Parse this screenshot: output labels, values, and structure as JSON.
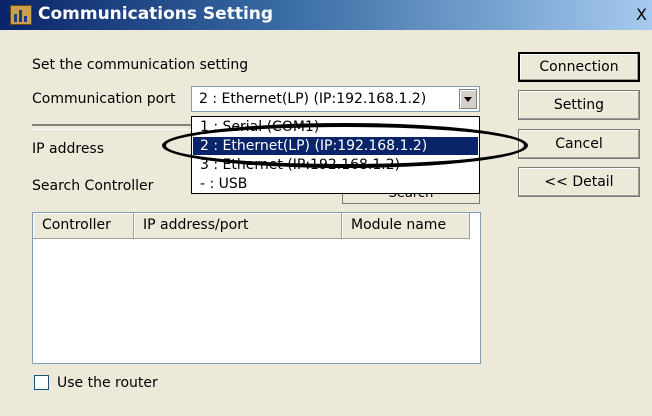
{
  "window": {
    "title": "Communications Setting",
    "close_glyph": "X",
    "icon": "app-icon"
  },
  "form": {
    "instruction": "Set the communication setting",
    "port_label": "Communication port",
    "port_value": "2 : Ethernet(LP) (IP:192.168.1.2)",
    "ip_label": "IP address",
    "search_label": "Search Controller",
    "search_button": "Search"
  },
  "dropdown": {
    "options": [
      "1 : Serial (COM1)",
      "2 : Ethernet(LP) (IP:192.168.1.2)",
      "3 : Ethernet (IP:192.168.1.2)",
      "- : USB"
    ],
    "selected_index": 1
  },
  "table": {
    "columns": [
      "Controller",
      "IP address/port",
      "Module name"
    ],
    "rows": []
  },
  "options": {
    "use_router_label": "Use the router",
    "use_router_checked": false
  },
  "buttons": {
    "connection": "Connection",
    "setting": "Setting",
    "cancel": "Cancel",
    "detail": "<< Detail"
  },
  "colors": {
    "selection": "#0a246a",
    "title_gradient_start": "#0a246a",
    "title_gradient_end": "#a6caf0",
    "dialog_face": "#ece9d8"
  }
}
